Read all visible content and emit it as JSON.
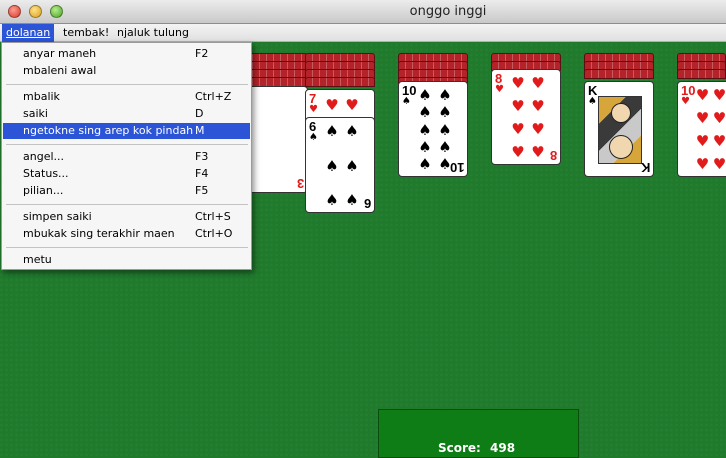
{
  "window": {
    "title": "onggo inggi",
    "buttons": [
      "close",
      "minimize",
      "zoom"
    ]
  },
  "menubar": {
    "items": [
      {
        "label": "dolanan",
        "mnemonic": "d",
        "active": true
      },
      {
        "label": "tembak!",
        "mnemonic": "t",
        "active": false
      },
      {
        "label": "njaluk tulung",
        "mnemonic": "n",
        "active": false
      }
    ]
  },
  "dolanan_menu": {
    "items": [
      {
        "label": "anyar maneh",
        "shortcut": "F2"
      },
      {
        "label": "mbaleni awal",
        "shortcut": ""
      },
      {
        "label": "mbalik",
        "shortcut": "Ctrl+Z"
      },
      {
        "label": "saiki",
        "shortcut": "D"
      },
      {
        "label": "ngetokne sing arep kok pindah",
        "shortcut": "M",
        "highlighted": true
      },
      {
        "label": "angel...",
        "shortcut": "F3"
      },
      {
        "label": "Status...",
        "shortcut": "F4"
      },
      {
        "label": "pilian...",
        "shortcut": "F5"
      },
      {
        "label": "simpen saiki",
        "shortcut": "Ctrl+S"
      },
      {
        "label": "mbukak sing terakhir maen",
        "shortcut": "Ctrl+O"
      },
      {
        "label": "metu",
        "shortcut": ""
      }
    ]
  },
  "tableau": {
    "visible_top_cards": [
      {
        "pile": 3,
        "cards": [
          "7 of hearts",
          "6 of spades"
        ]
      },
      {
        "pile": 4,
        "cards": [
          "10 of spades"
        ]
      },
      {
        "pile": 5,
        "cards": [
          "8 of hearts"
        ]
      },
      {
        "pile": 6,
        "cards": [
          "K of spades"
        ]
      },
      {
        "pile": 7,
        "cards": [
          "10 of hearts"
        ]
      }
    ]
  },
  "card_text": {
    "seven": "7",
    "six": "6",
    "ten": "10",
    "eight": "8",
    "king": "K",
    "three": "3",
    "heart": "♥",
    "spade": "♠"
  },
  "score": {
    "label": "Score:",
    "value": "498"
  },
  "colors": {
    "felt": "#1f7a2c",
    "menu_highlight": "#2b54d6",
    "card_back": "#b4232a",
    "score_panel": "#0f7d16"
  }
}
